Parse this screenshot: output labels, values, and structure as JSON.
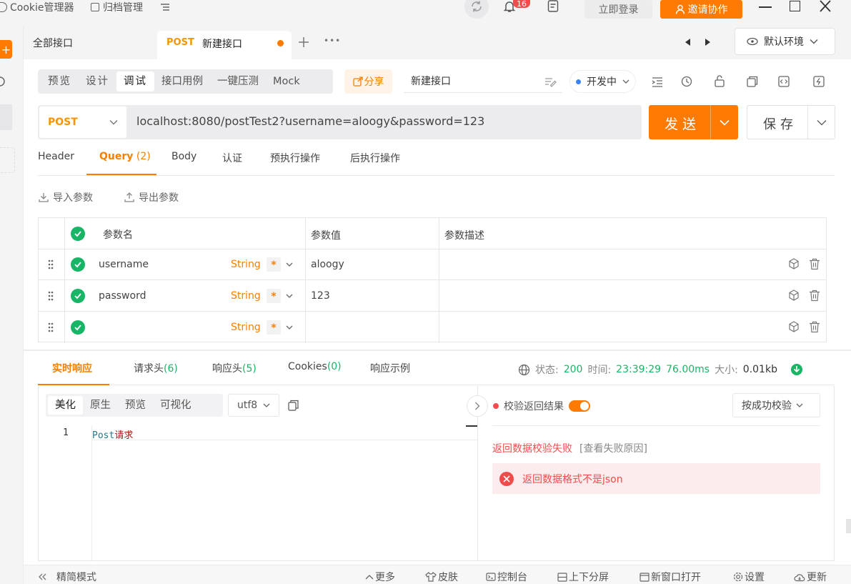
{
  "topbar": {
    "cookie_label": "Cookie管理器",
    "archive_label": "归档管理",
    "notification_count": "16",
    "login_label": "立即登录",
    "invite_label": "邀请协作"
  },
  "tabs": {
    "all_label": "全部接口",
    "active_method": "POST",
    "active_name": "新建接口",
    "more_label": "•••",
    "env_label": "默认环境"
  },
  "modes": [
    "预览",
    "设计",
    "调试",
    "接口用例",
    "一键压测",
    "Mock"
  ],
  "active_mode": "调试",
  "share_label": "分享",
  "api_name": "新建接口",
  "dev_status": "开发中",
  "request": {
    "method": "POST",
    "url": "localhost:8080/postTest2?username=aloogy&password=123",
    "send_label": "发送",
    "save_label": "保存"
  },
  "req_tabs": {
    "header": "Header",
    "query": "Query",
    "query_count": "(2)",
    "body": "Body",
    "auth": "认证",
    "pre": "预执行操作",
    "post": "后执行操作"
  },
  "param_actions": {
    "import": "导入参数",
    "export": "导出参数"
  },
  "params_table": {
    "headers": [
      "参数名",
      "参数值",
      "参数描述"
    ],
    "rows": [
      {
        "name": "username",
        "type": "String",
        "required": "*",
        "value": "aloogy",
        "desc": ""
      },
      {
        "name": "password",
        "type": "String",
        "required": "*",
        "value": "123",
        "desc": ""
      },
      {
        "name": "",
        "type": "String",
        "required": "*",
        "value": "",
        "desc": ""
      }
    ]
  },
  "response": {
    "tabs": {
      "realtime": "实时响应",
      "req_headers": "请求头",
      "req_headers_count": "(6)",
      "resp_headers": "响应头",
      "resp_headers_count": "(5)",
      "cookies": "Cookies",
      "cookies_count": "(0)",
      "example": "响应示例"
    },
    "status_label": "状态:",
    "status_value": "200",
    "time_label": "时间:",
    "time_value": "23:39:29",
    "duration": "76.00ms",
    "size_label": "大小:",
    "size_value": "0.01kb",
    "view_tabs": [
      "美化",
      "原生",
      "预览",
      "可视化"
    ],
    "encoding": "utf8",
    "line_number": "1",
    "code_ascii": "Post",
    "code_cjk": "请求",
    "verify_label": "校验返回结果",
    "verify_mode": "按成功校验",
    "verify_fail": "返回数据校验失败",
    "view_reason": "[查看失败原因]",
    "error_message": "返回数据格式不是json"
  },
  "statusbar": {
    "simple_mode": "精简模式",
    "more": "更多",
    "skin": "皮肤",
    "console": "控制台",
    "split": "上下分屏",
    "new_window": "新窗口打开",
    "settings": "设置",
    "update": "更新"
  },
  "colors": {
    "accent": "#ff7a00",
    "success": "#18b566",
    "error": "#f04c4c"
  }
}
